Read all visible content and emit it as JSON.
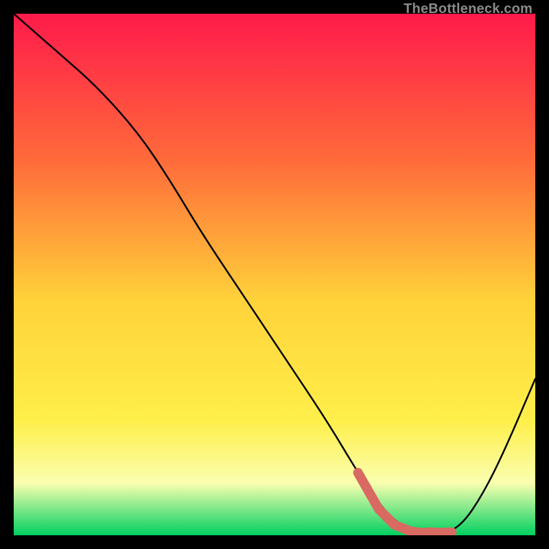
{
  "watermark": "TheBottleneck.com",
  "colors": {
    "gradient_top": "#ff1a4b",
    "gradient_mid1": "#ff6a3a",
    "gradient_mid2": "#ffd23a",
    "gradient_mid3": "#ffef4a",
    "gradient_mid4": "#faffb0",
    "gradient_bottom": "#00d060",
    "curve": "#000000",
    "highlight": "#d86a62",
    "frame_bg": "#000000"
  },
  "chart_data": {
    "type": "line",
    "title": "",
    "xlabel": "",
    "ylabel": "",
    "xlim": [
      0,
      100
    ],
    "ylim": [
      0,
      100
    ],
    "series": [
      {
        "name": "bottleneck-curve",
        "x": [
          0,
          8,
          16,
          24,
          30,
          36,
          44,
          52,
          60,
          66,
          70,
          74,
          78,
          82,
          86,
          90,
          94,
          100
        ],
        "y": [
          100,
          93,
          86,
          77,
          68,
          58,
          46,
          34,
          22,
          12,
          6,
          2,
          0,
          0,
          2,
          8,
          16,
          30
        ]
      }
    ],
    "highlight_segment": {
      "name": "optimal-range",
      "x": [
        66,
        70,
        73,
        76,
        78,
        80,
        82,
        84
      ],
      "y": [
        12,
        5,
        2,
        0.8,
        0.5,
        0.6,
        0.5,
        0.6
      ]
    }
  }
}
